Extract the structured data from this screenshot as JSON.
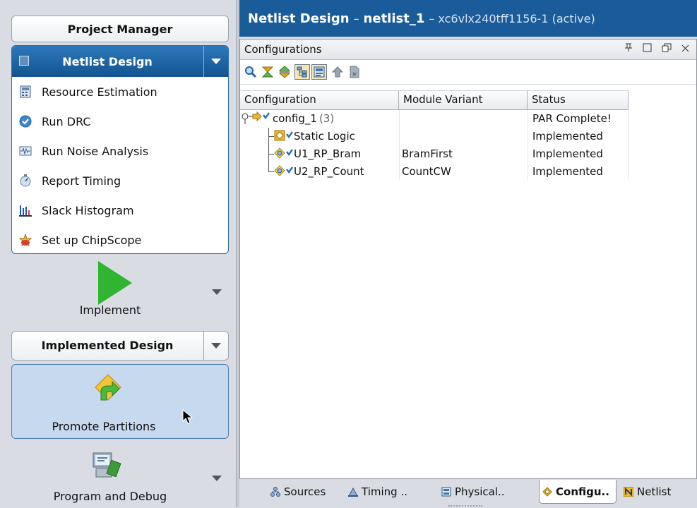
{
  "left_nav": {
    "project_manager": "Project Manager",
    "netlist_design": {
      "title": "Netlist Design",
      "items": [
        {
          "label": "Resource Estimation",
          "icon": "calculator-icon"
        },
        {
          "label": "Run DRC",
          "icon": "check-circle-icon"
        },
        {
          "label": "Run Noise Analysis",
          "icon": "waveform-icon"
        },
        {
          "label": "Report Timing",
          "icon": "stopwatch-icon"
        },
        {
          "label": "Slack Histogram",
          "icon": "histogram-icon"
        },
        {
          "label": "Set up ChipScope",
          "icon": "chipscope-icon"
        }
      ]
    },
    "implement": "Implement",
    "implemented_design": "Implemented Design",
    "promote_partitions": "Promote Partitions",
    "program_and_debug": "Program and Debug"
  },
  "title_bar": {
    "main": "Netlist Design",
    "dash": "–",
    "name": "netlist_1",
    "device": "– xc6vlx240tff1156-1 (active)"
  },
  "configurations": {
    "title": "Configurations",
    "window_controls": [
      "ᵖ",
      "☐",
      "⧉",
      "×"
    ],
    "columns": [
      "Configuration",
      "Module Variant",
      "Status"
    ],
    "rows": [
      {
        "name": "config_1",
        "count": "(3)",
        "variant": "",
        "status": "PAR Complete!"
      },
      {
        "name": "Static Logic",
        "variant": "",
        "status": "Implemented"
      },
      {
        "name": "U1_RP_Bram",
        "variant": "BramFirst",
        "status": "Implemented"
      },
      {
        "name": "U2_RP_Count",
        "variant": "CountCW",
        "status": "Implemented"
      }
    ]
  },
  "tabs": [
    {
      "label": "Sources",
      "icon": "sources-icon"
    },
    {
      "label": "Timing ..",
      "icon": "timing-icon"
    },
    {
      "label": "Physical..",
      "icon": "physical-icon"
    },
    {
      "label": "Configu..",
      "icon": "configurations-icon",
      "active": true
    },
    {
      "label": "Netlist",
      "icon": "netlist-icon"
    }
  ]
}
